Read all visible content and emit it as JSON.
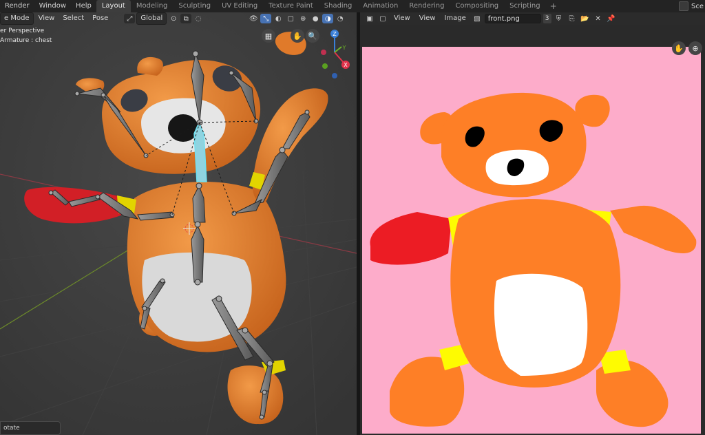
{
  "topbar": {
    "menus": [
      "Render",
      "Window",
      "Help"
    ],
    "workspace_tabs": [
      {
        "label": "Layout",
        "active": true
      },
      {
        "label": "Modeling",
        "active": false
      },
      {
        "label": "Sculpting",
        "active": false
      },
      {
        "label": "UV Editing",
        "active": false
      },
      {
        "label": "Texture Paint",
        "active": false
      },
      {
        "label": "Shading",
        "active": false
      },
      {
        "label": "Animation",
        "active": false
      },
      {
        "label": "Rendering",
        "active": false
      },
      {
        "label": "Compositing",
        "active": false
      },
      {
        "label": "Scripting",
        "active": false
      }
    ],
    "add_workspace": "+",
    "scene_label": "Sce"
  },
  "viewport": {
    "mode_label": "e Mode",
    "menu_view": "View",
    "menu_select": "Select",
    "menu_pose": "Pose",
    "transform_orientation": "Global",
    "view_name": "er Perspective",
    "active_object": "Armature : chest",
    "status_hint": "otate",
    "gizmo_z": "Z",
    "gizmo_y": "Y",
    "gizmo_x": "X"
  },
  "image_editor": {
    "menu_view": "View",
    "menu_view2": "View",
    "menu_image": "Image",
    "filename": "front.png",
    "users": "3"
  },
  "colors": {
    "accent_blue": "#4772b3",
    "bear_orange": "#fe7f26",
    "bear_yellow": "#fefb01",
    "bear_red": "#ec1c24",
    "canvas_pink": "#fdacca"
  }
}
